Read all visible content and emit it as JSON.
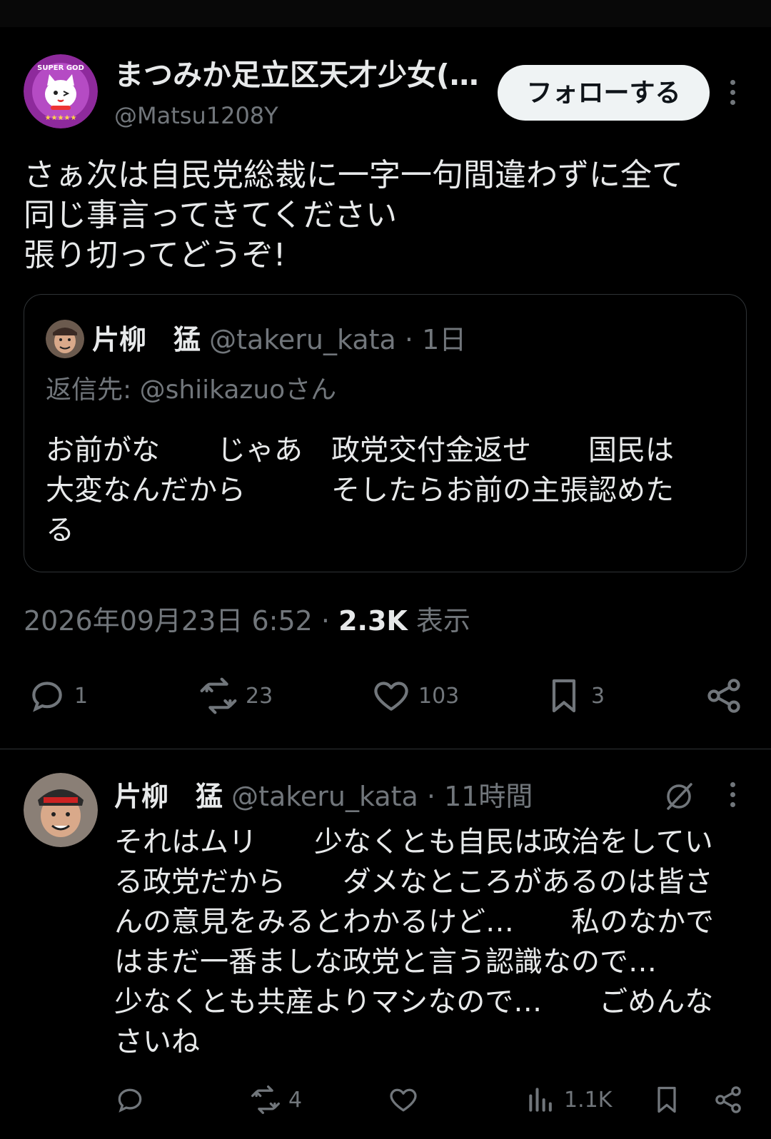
{
  "post": {
    "display_name": "まつみか足立区天才少女(…",
    "handle": "@Matsu1208Y",
    "follow_label": "フォローする",
    "avatar_badge": "SUPER GOD",
    "text_lines": [
      "さぁ次は自民党総裁に一字一句間違わずに全て",
      "同じ事言ってきてください",
      "張り切ってどうぞ!"
    ],
    "timestamp": "2026年09月23日 6:52 · ",
    "views_count": "2.3K",
    "views_label": " 表示",
    "actions": {
      "reply_count": "1",
      "repost_count": "23",
      "like_count": "103",
      "bookmark_count": "3"
    }
  },
  "quote": {
    "name": "片柳　猛",
    "meta": " @takeru_kata · 1日",
    "reply_to": "返信先: @shiikazuoさん",
    "body_lines": [
      "お前がな　　じゃあ　政党交付金返せ　　国民は",
      "大変なんだから　　　そしたらお前の主張認めた",
      "る"
    ]
  },
  "reply": {
    "name": "片柳　猛",
    "meta": " @takeru_kata · 11時間",
    "text_lines": [
      "それはムリ　　少なくとも自民は政治をしてい",
      "る政党だから　　ダメなところがあるのは皆さ",
      "んの意見をみるとわかるけど…　　私のなかで",
      "はまだ一番ましな政党と言う認識なので…",
      "少なくとも共産よりマシなので…　　ごめんな",
      "さいね"
    ],
    "actions": {
      "repost_count": "4",
      "views_count": "1.1K"
    }
  },
  "colors": {
    "background": "#000000",
    "text": "#e7e9ea",
    "muted": "#71767b",
    "follow_bg": "#eff3f4",
    "avatar_purple": "#8e2a9c"
  }
}
